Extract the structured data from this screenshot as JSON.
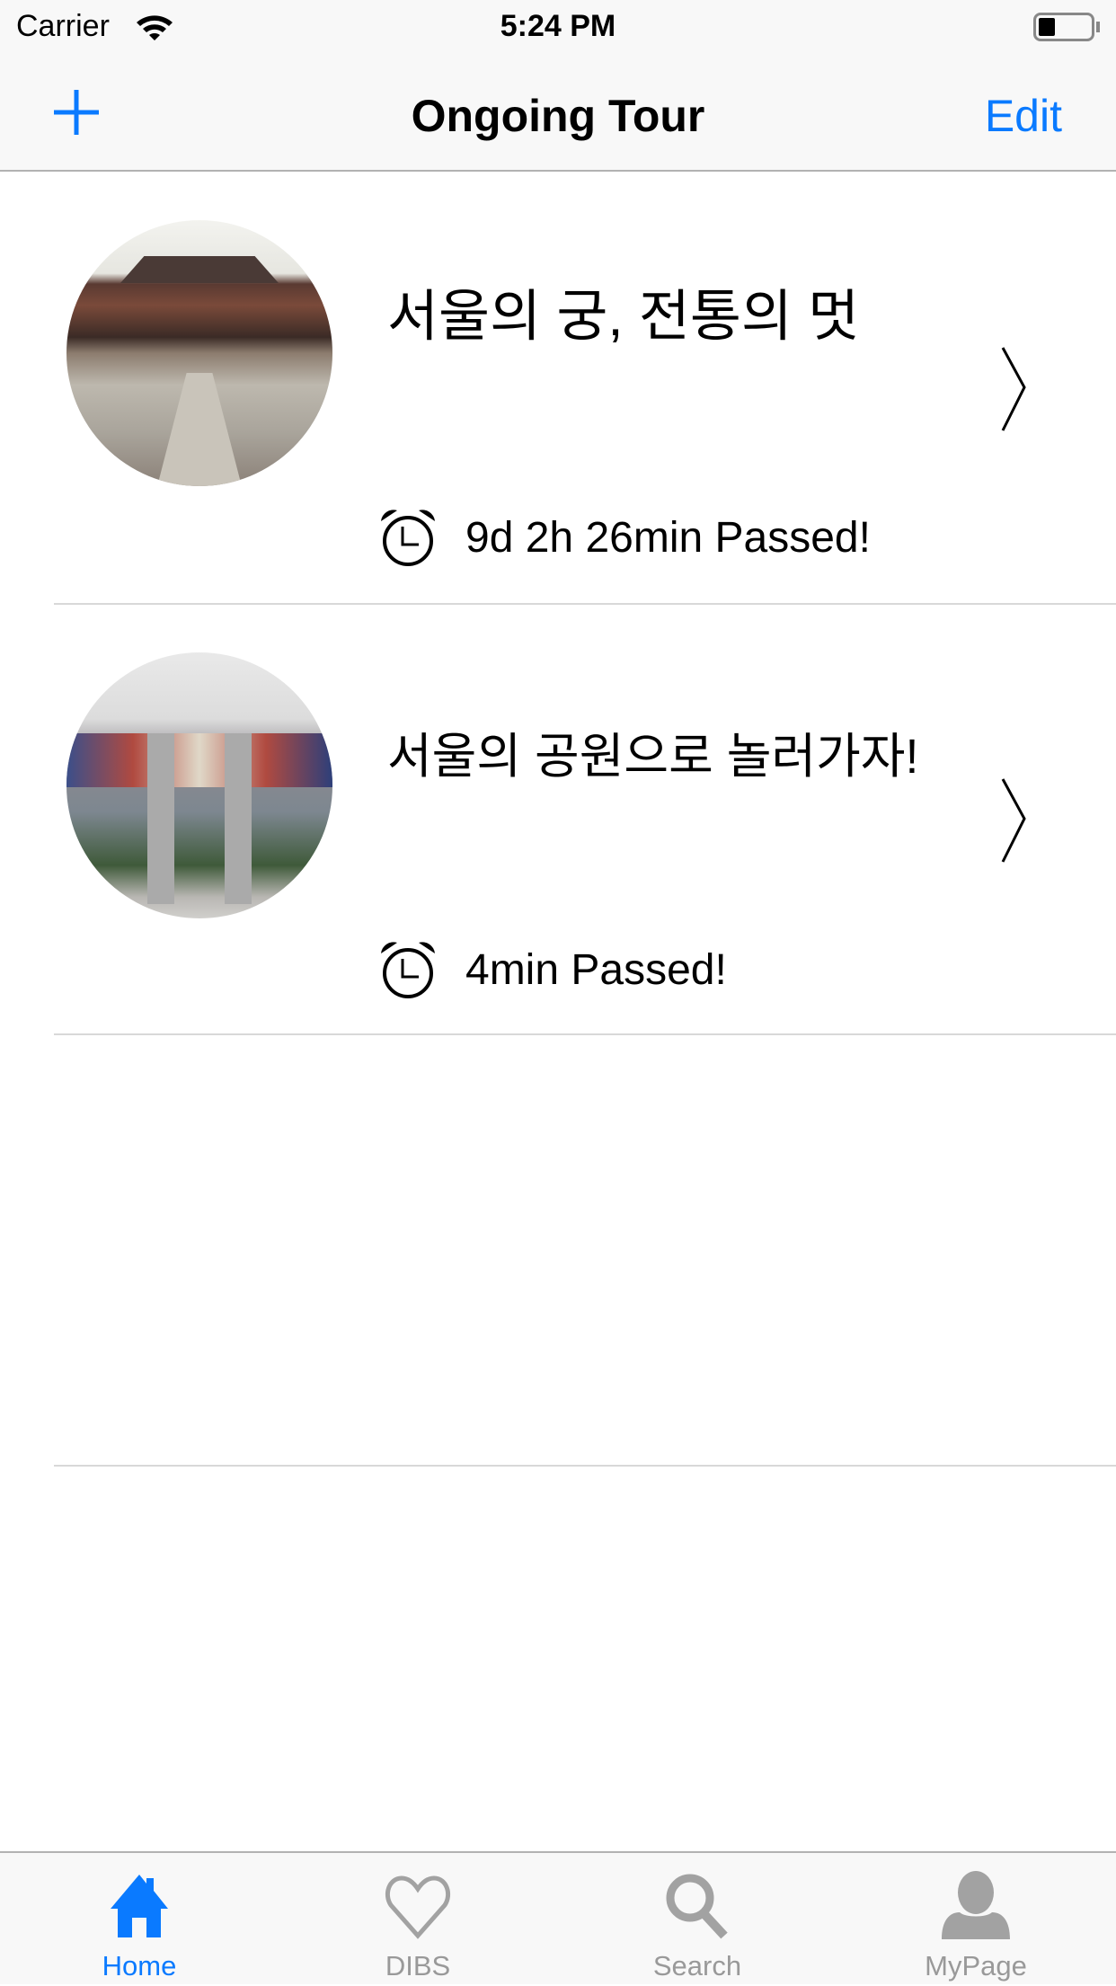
{
  "status": {
    "carrier": "Carrier",
    "time": "5:24 PM",
    "battery_level": 0.3
  },
  "nav": {
    "title": "Ongoing Tour",
    "edit_label": "Edit",
    "add_icon": "plus-icon"
  },
  "tours": [
    {
      "title": "서울의 궁, 전통의 멋",
      "elapsed": "9d 2h 26min Passed!"
    },
    {
      "title": "서울의 공원으로 놀러가자!",
      "elapsed": "4min Passed!"
    }
  ],
  "tabs": [
    {
      "label": "Home",
      "icon": "home-icon",
      "active": true
    },
    {
      "label": "DIBS",
      "icon": "heart-icon"
    },
    {
      "label": "Search",
      "icon": "search-icon"
    },
    {
      "label": "MyPage",
      "icon": "person-icon"
    }
  ],
  "colors": {
    "accent": "#0a7aff",
    "inactive": "#999999"
  }
}
